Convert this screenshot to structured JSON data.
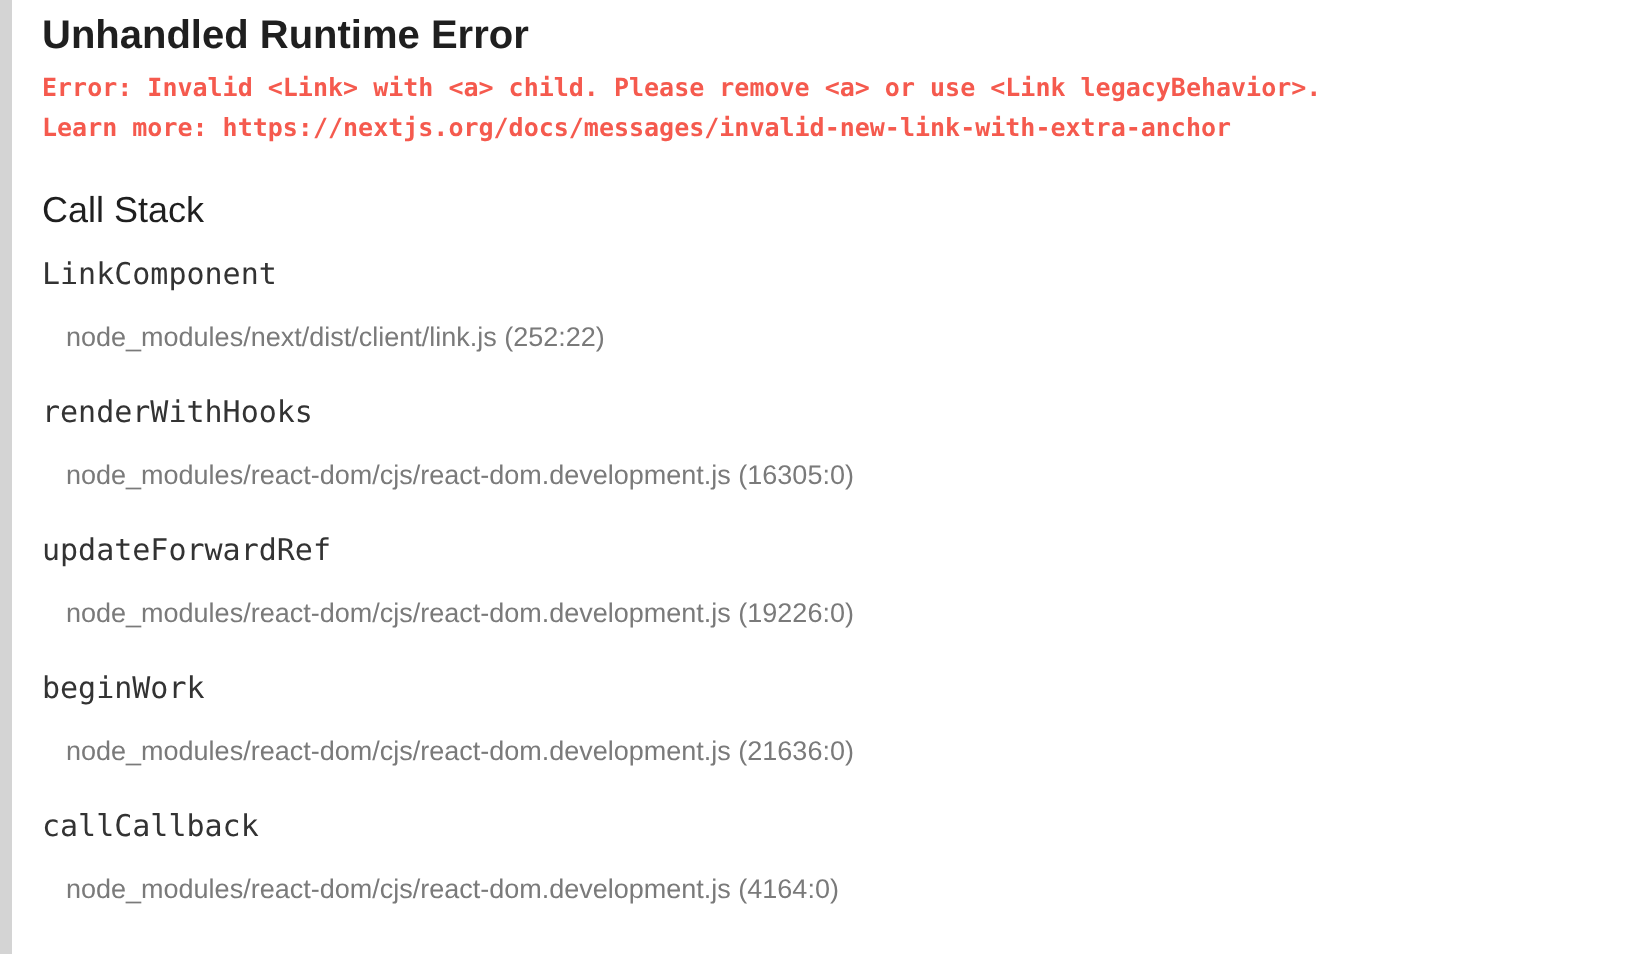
{
  "title": "Unhandled Runtime Error",
  "error_lines": [
    "Error: Invalid <Link> with <a> child. Please remove <a> or use <Link legacyBehavior>.",
    "Learn more: https://nextjs.org/docs/messages/invalid-new-link-with-extra-anchor"
  ],
  "call_stack": {
    "heading": "Call Stack",
    "frames": [
      {
        "function": "LinkComponent",
        "location": "node_modules/next/dist/client/link.js (252:22)"
      },
      {
        "function": "renderWithHooks",
        "location": "node_modules/react-dom/cjs/react-dom.development.js (16305:0)"
      },
      {
        "function": "updateForwardRef",
        "location": "node_modules/react-dom/cjs/react-dom.development.js (19226:0)"
      },
      {
        "function": "beginWork",
        "location": "node_modules/react-dom/cjs/react-dom.development.js (21636:0)"
      },
      {
        "function": "callCallback",
        "location": "node_modules/react-dom/cjs/react-dom.development.js (4164:0)"
      }
    ]
  }
}
